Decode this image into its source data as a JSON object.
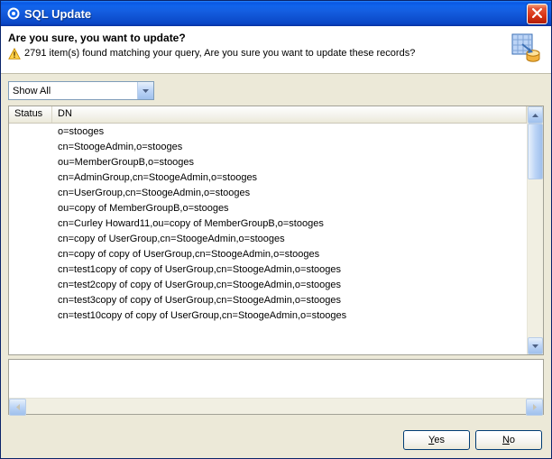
{
  "window": {
    "title": "SQL Update"
  },
  "header": {
    "title": "Are you sure, you want to update?",
    "message": "2791 item(s) found matching your query, Are you sure you want to update these records?"
  },
  "filter": {
    "selected": "Show All"
  },
  "table": {
    "columns": {
      "status": "Status",
      "dn": "DN"
    },
    "rows": [
      {
        "status": "",
        "dn": "o=stooges"
      },
      {
        "status": "",
        "dn": "cn=StoogeAdmin,o=stooges"
      },
      {
        "status": "",
        "dn": "ou=MemberGroupB,o=stooges"
      },
      {
        "status": "",
        "dn": "cn=AdminGroup,cn=StoogeAdmin,o=stooges"
      },
      {
        "status": "",
        "dn": "cn=UserGroup,cn=StoogeAdmin,o=stooges"
      },
      {
        "status": "",
        "dn": "ou=copy of MemberGroupB,o=stooges"
      },
      {
        "status": "",
        "dn": "cn=Curley Howard11,ou=copy of MemberGroupB,o=stooges"
      },
      {
        "status": "",
        "dn": "cn=copy of UserGroup,cn=StoogeAdmin,o=stooges"
      },
      {
        "status": "",
        "dn": "cn=copy of copy of UserGroup,cn=StoogeAdmin,o=stooges"
      },
      {
        "status": "",
        "dn": "cn=test1copy of copy of UserGroup,cn=StoogeAdmin,o=stooges"
      },
      {
        "status": "",
        "dn": "cn=test2copy of copy of UserGroup,cn=StoogeAdmin,o=stooges"
      },
      {
        "status": "",
        "dn": "cn=test3copy of copy of UserGroup,cn=StoogeAdmin,o=stooges"
      },
      {
        "status": "",
        "dn": "cn=test10copy of copy of UserGroup,cn=StoogeAdmin,o=stooges"
      }
    ]
  },
  "textarea": {
    "value": ""
  },
  "buttons": {
    "yes": "Yes",
    "no": "No"
  }
}
